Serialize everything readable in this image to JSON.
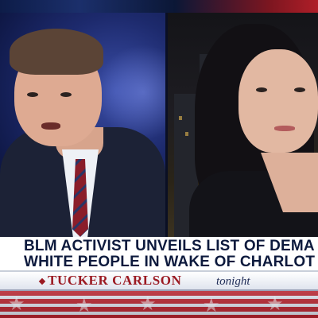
{
  "headline": {
    "line1": "BLM ACTIVIST UNVEILS LIST OF DEMA",
    "line2": "WHITE PEOPLE IN WAKE OF CHARLOT"
  },
  "show": {
    "title": "TUCKER CARLSON",
    "suffix": "tonight"
  },
  "colors": {
    "headline_text": "#0d1a3d",
    "show_title": "#9b1a22",
    "flag_red": "#b3202c",
    "banner_bg": "#ffffff"
  },
  "icons": [
    "star-icon"
  ]
}
